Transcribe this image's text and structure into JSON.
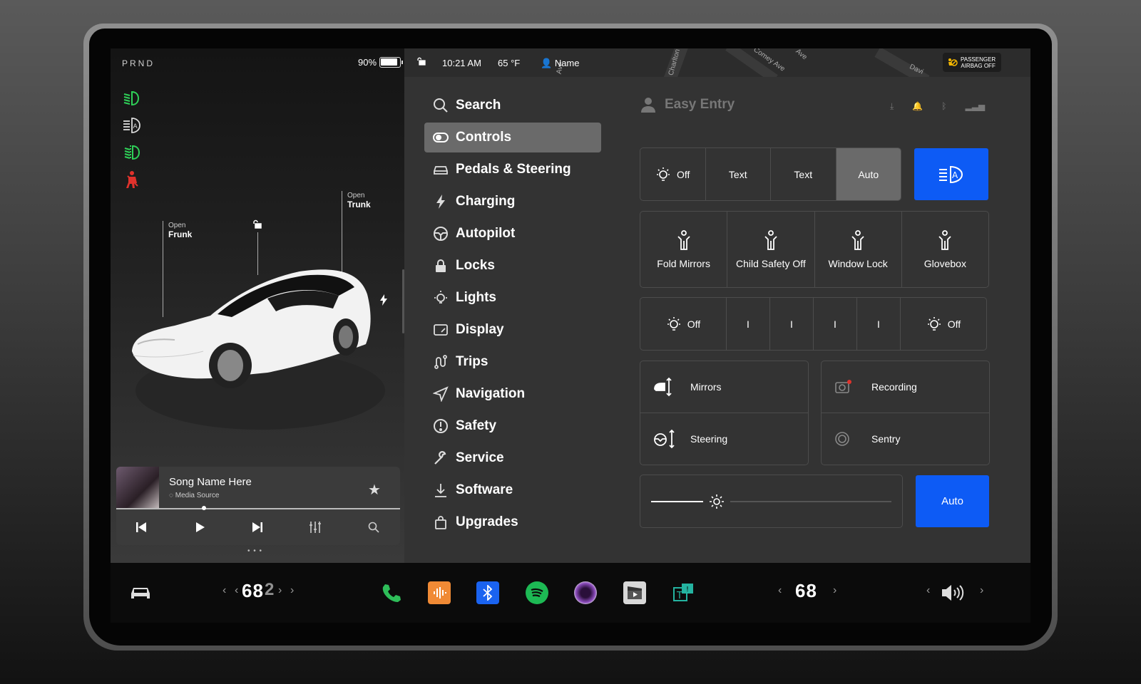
{
  "left_pane": {
    "gear": "PRND",
    "battery_pct": "90%",
    "battery_level": 0.9,
    "callouts": {
      "frunk_small": "Open",
      "frunk_big": "Frunk",
      "trunk_small": "Open",
      "trunk_big": "Trunk"
    },
    "telltales": [
      "low-beam-icon",
      "auto-headlights-icon",
      "fog-light-icon",
      "seatbelt-warning-icon"
    ]
  },
  "player": {
    "song": "Song Name Here",
    "source": "Media Source",
    "progress": 0.31,
    "controls": [
      "previous-icon",
      "play-icon",
      "next-icon",
      "equalizer-icon",
      "search-icon"
    ]
  },
  "topbar": {
    "time": "10:21 AM",
    "temp": "65 °F",
    "user": "Name",
    "airbag_line1": "PASSENGER",
    "airbag_line2": "AIRBAG OFF",
    "map_labels": [
      "Charlton",
      "Comey Ave",
      "Ave",
      "Davi",
      "Ave"
    ]
  },
  "menu": {
    "items": [
      {
        "label": "Search",
        "icon": "search-icon"
      },
      {
        "label": "Controls",
        "icon": "toggle-icon"
      },
      {
        "label": "Pedals & Steering",
        "icon": "car-icon"
      },
      {
        "label": "Charging",
        "icon": "bolt-icon"
      },
      {
        "label": "Autopilot",
        "icon": "steering-wheel-icon"
      },
      {
        "label": "Locks",
        "icon": "lock-icon"
      },
      {
        "label": "Lights",
        "icon": "bulb-icon"
      },
      {
        "label": "Display",
        "icon": "display-icon"
      },
      {
        "label": "Trips",
        "icon": "trips-icon"
      },
      {
        "label": "Navigation",
        "icon": "navigation-icon"
      },
      {
        "label": "Safety",
        "icon": "safety-icon"
      },
      {
        "label": "Service",
        "icon": "wrench-icon"
      },
      {
        "label": "Software",
        "icon": "download-icon"
      },
      {
        "label": "Upgrades",
        "icon": "bag-icon"
      }
    ],
    "active_index": 1
  },
  "controls": {
    "easy_entry": "Easy Entry",
    "lights_segments": [
      "Off",
      "Text",
      "Text",
      "Auto"
    ],
    "lights_selected": 3,
    "quick_tiles": [
      "Fold Mirrors",
      "Child Safety Off",
      "Window Lock",
      "Glovebox"
    ],
    "dim_segments": [
      "Off",
      "I",
      "I",
      "I",
      "I",
      "Off"
    ],
    "mirrors": "Mirrors",
    "steering": "Steering",
    "recording": "Recording",
    "sentry": "Sentry",
    "brightness_level": 0.24,
    "auto_button": "Auto"
  },
  "dock": {
    "driver_temp": "68",
    "passenger_temp": "68",
    "apps": [
      "phone-icon",
      "voice-icon",
      "bluetooth-icon",
      "spotify-icon",
      "camera-icon",
      "theater-icon",
      "toybox-icon"
    ],
    "colors": {
      "phone": "#2ebd59",
      "voice": "#f08a35",
      "bluetooth": "#1a63f0",
      "spotify": "#1db954",
      "toybox": "#24b3a0"
    }
  }
}
